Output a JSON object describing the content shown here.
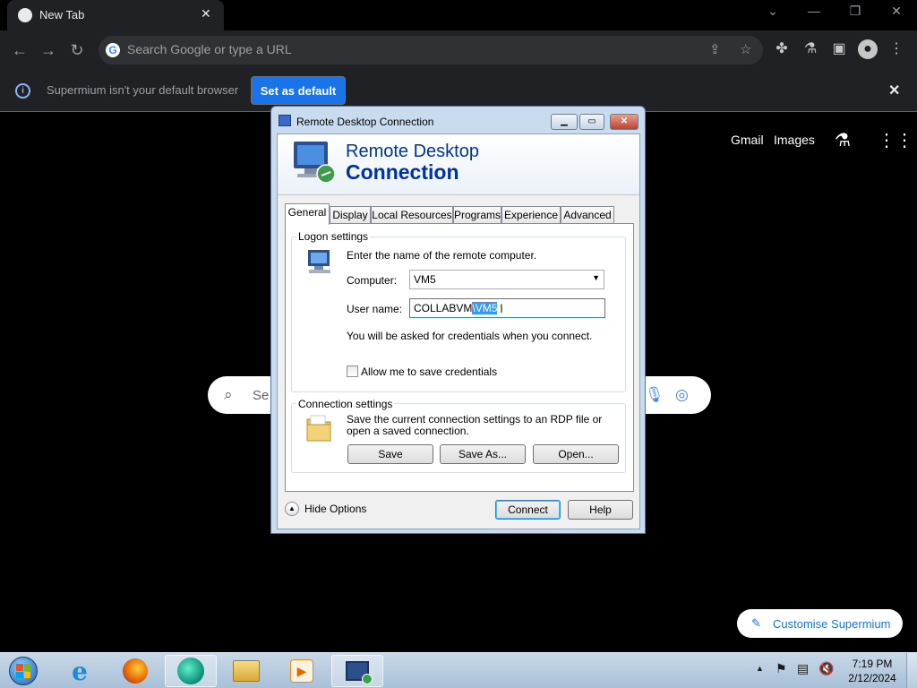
{
  "browser": {
    "tab_title": "New Tab",
    "omnibox_placeholder": "Search Google or type a URL",
    "infobar": {
      "message": "Supermium isn't your default browser",
      "button": "Set as default"
    },
    "links": {
      "gmail": "Gmail",
      "images": "Images"
    },
    "search_partial": "Se",
    "customise": "Customise Supermium"
  },
  "dialog": {
    "title": "Remote Desktop Connection",
    "banner_line1": "Remote Desktop",
    "banner_line2": "Connection",
    "tabs": [
      "General",
      "Display",
      "Local Resources",
      "Programs",
      "Experience",
      "Advanced"
    ],
    "selected_tab": "General",
    "logon": {
      "title": "Logon settings",
      "instruction": "Enter the name of the remote computer.",
      "computer_label": "Computer:",
      "computer_value": "VM5",
      "username_label": "User name:",
      "username_prefix": "COLLABVM",
      "username_selected": "\\VM5",
      "credentials_note": "You will be asked for credentials when you connect.",
      "save_credentials": "Allow me to save credentials"
    },
    "connection": {
      "title": "Connection settings",
      "description": "Save the current connection settings to an RDP file or open a saved connection.",
      "save": "Save",
      "save_as": "Save As...",
      "open": "Open..."
    },
    "hide_options": "Hide Options",
    "connect": "Connect",
    "help": "Help"
  },
  "taskbar": {
    "time": "7:19 PM",
    "date": "2/12/2024"
  },
  "colors": {
    "accent": "#1a73e8",
    "chrome_bg": "#202124",
    "rdp_blue": "#003399"
  }
}
